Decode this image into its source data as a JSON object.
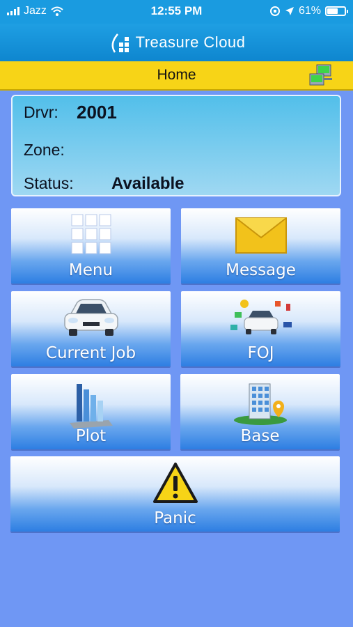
{
  "status_bar": {
    "carrier": "Jazz",
    "time": "12:55 PM",
    "battery": "61%",
    "battery_level": 0.61
  },
  "brand": {
    "name": "Treasure Cloud"
  },
  "header": {
    "title": "Home",
    "connection_icon": "network-icon"
  },
  "driver_info": {
    "driver_label": "Drvr:",
    "driver_value": "2001",
    "zone_label": "Zone:",
    "zone_value": "",
    "status_label": "Status:",
    "status_value": "Available"
  },
  "tiles": [
    {
      "id": "menu",
      "label": "Menu",
      "icon": "grid-icon"
    },
    {
      "id": "message",
      "label": "Message",
      "icon": "envelope-icon"
    },
    {
      "id": "current-job",
      "label": "Current Job",
      "icon": "car-icon"
    },
    {
      "id": "foj",
      "label": "FOJ",
      "icon": "car-services-icon"
    },
    {
      "id": "plot",
      "label": "Plot",
      "icon": "bar-chart-icon"
    },
    {
      "id": "base",
      "label": "Base",
      "icon": "building-icon"
    },
    {
      "id": "panic",
      "label": "Panic",
      "icon": "warning-icon"
    }
  ],
  "colors": {
    "background": "#6f97f4",
    "status_bar": "#1a9be0",
    "title_bar": "#f7d417",
    "tile_bottom": "#2d7ee2"
  }
}
